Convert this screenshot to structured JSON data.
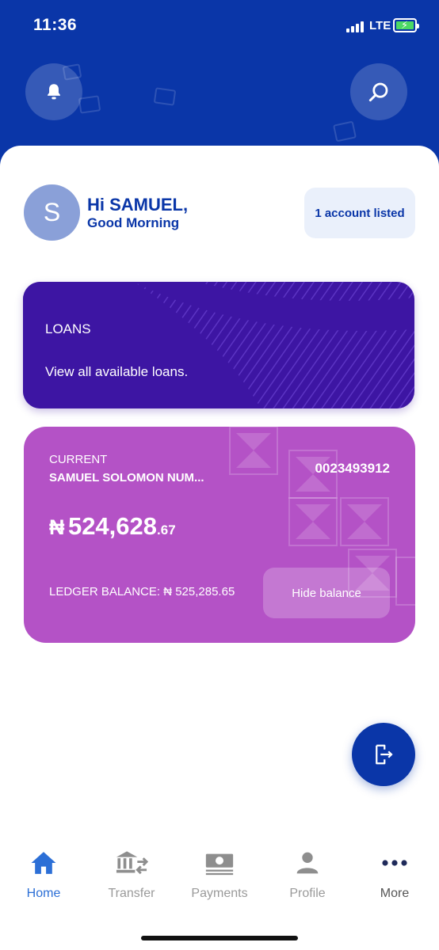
{
  "status_bar": {
    "time": "11:36",
    "network": "LTE"
  },
  "header": {
    "bell_icon": "bell-icon",
    "search_icon": "search-icon"
  },
  "greeting": {
    "avatar_letter": "S",
    "name_line": "Hi SAMUEL,",
    "sub_line": "Good Morning"
  },
  "accounts_pill": "1 account listed",
  "loans_card": {
    "title": "LOANS",
    "subtitle": "View all available loans."
  },
  "account_card": {
    "type": "CURRENT",
    "name": "SAMUEL SOLOMON NUM...",
    "number": "0023493912",
    "currency": "₦",
    "balance_main": "524,628",
    "balance_decimal": ".67",
    "ledger_label": "LEDGER BALANCE: ₦ 525,285.65",
    "hide_label": "Hide balance"
  },
  "fab_icon": "logout-icon",
  "bottom_nav": [
    {
      "label": "Home",
      "icon": "home-icon",
      "active": true
    },
    {
      "label": "Transfer",
      "icon": "bank-transfer-icon",
      "active": false
    },
    {
      "label": "Payments",
      "icon": "money-icon",
      "active": false
    },
    {
      "label": "Profile",
      "icon": "person-icon",
      "active": false
    },
    {
      "label": "More",
      "icon": "more-dots-icon",
      "active": false
    }
  ],
  "colors": {
    "brand_blue": "#0a36a8",
    "loans_purple": "#3d15a3",
    "account_magenta": "#b452c6",
    "nav_active": "#2c6fd6",
    "nav_inactive": "#9a9a9a"
  }
}
